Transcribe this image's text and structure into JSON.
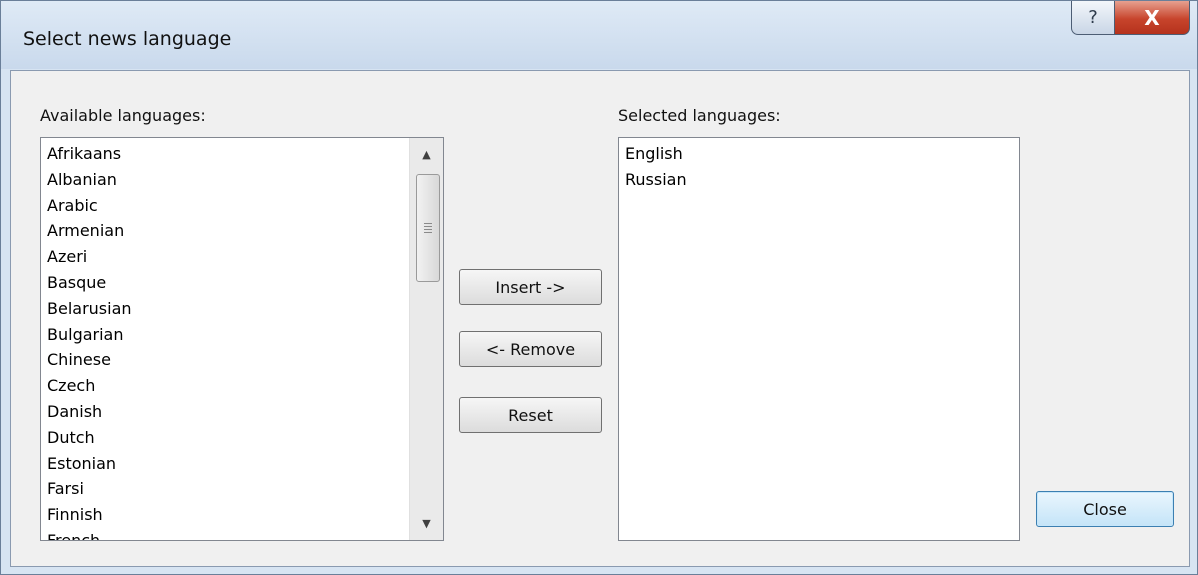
{
  "window": {
    "title": "Select news language",
    "help_glyph": "?",
    "close_glyph": "X"
  },
  "available": {
    "label": "Available languages:",
    "items": [
      "Afrikaans",
      "Albanian",
      "Arabic",
      "Armenian",
      "Azeri",
      "Basque",
      "Belarusian",
      "Bulgarian",
      "Chinese",
      "Czech",
      "Danish",
      "Dutch",
      "Estonian",
      "Farsi",
      "Finnish",
      "French"
    ],
    "scroll_up_icon": "▲",
    "scroll_down_icon": "▼"
  },
  "selected": {
    "label": "Selected languages:",
    "items": [
      "English",
      "Russian"
    ]
  },
  "buttons": {
    "insert": "Insert ->",
    "remove": "<- Remove",
    "reset": "Reset",
    "close": "Close"
  },
  "colors": {
    "close_button_red": "#c7442c",
    "title_bar": "#dfeaf6",
    "default_button_border": "#3c7fb1"
  }
}
